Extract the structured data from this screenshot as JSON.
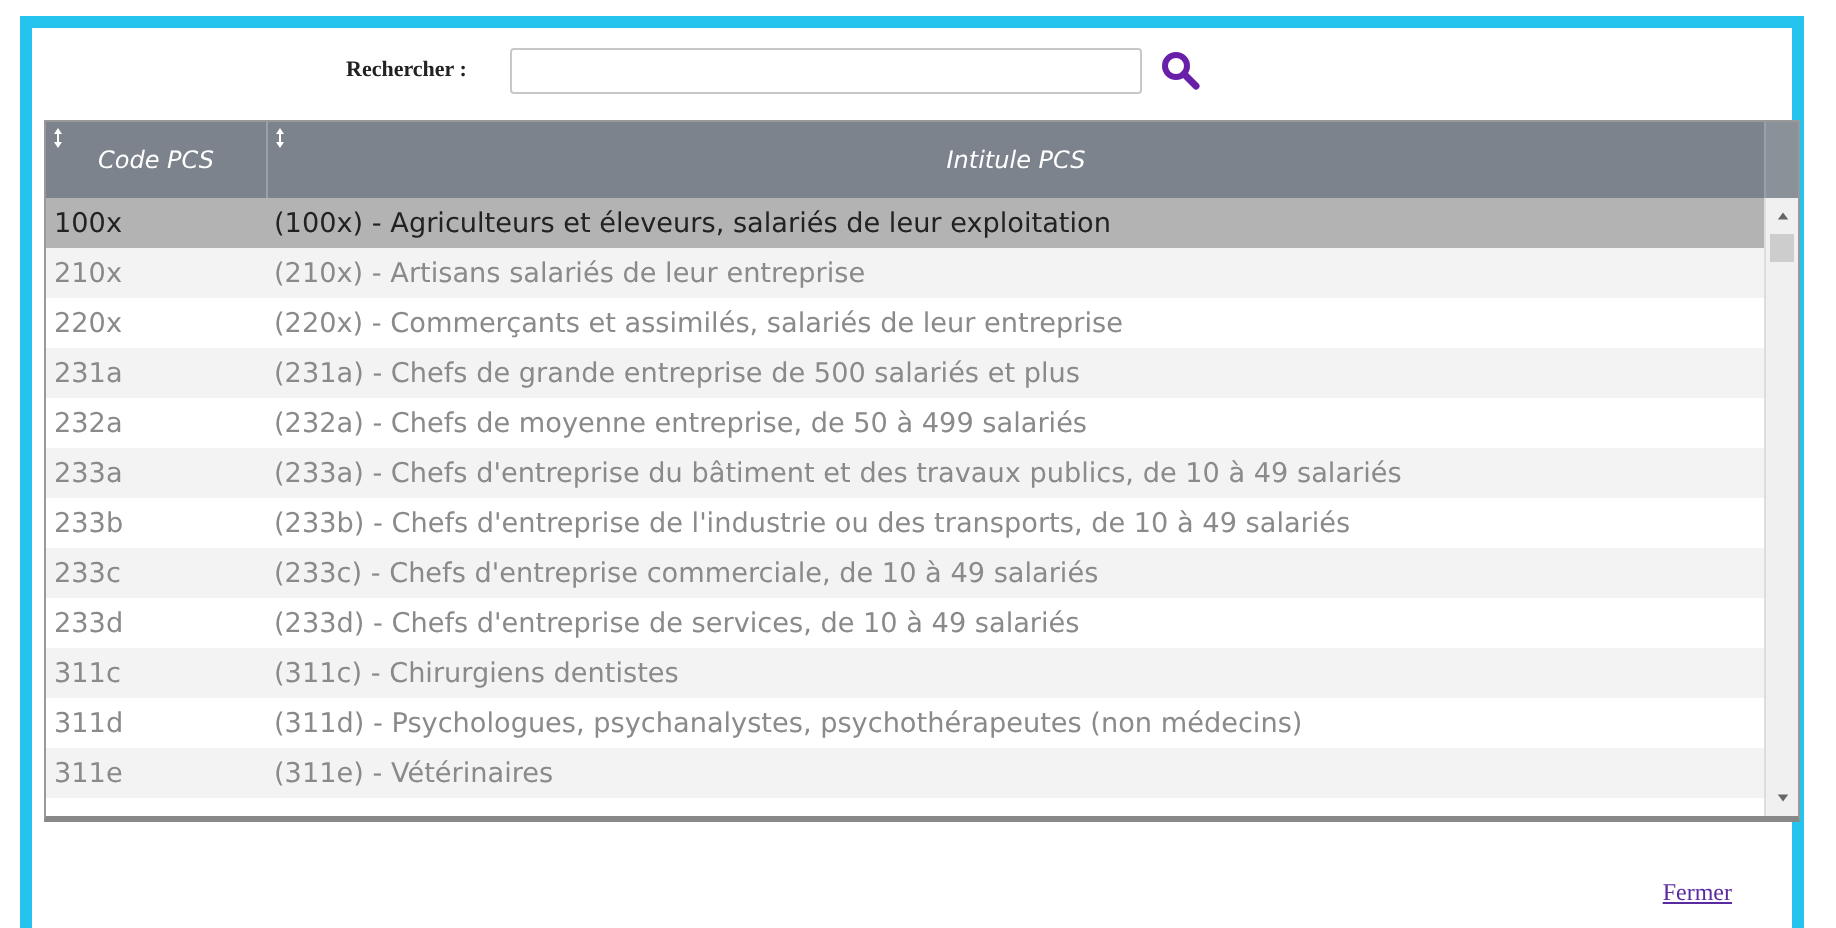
{
  "search": {
    "label": "Rechercher :"
  },
  "table": {
    "columns": [
      "Code PCS",
      "Intitule PCS"
    ],
    "rows": [
      {
        "code": "100x",
        "label": "(100x) - Agriculteurs et éleveurs, salariés de leur exploitation",
        "selected": true
      },
      {
        "code": "210x",
        "label": "(210x) - Artisans salariés de leur entreprise",
        "selected": false
      },
      {
        "code": "220x",
        "label": "(220x) - Commerçants et assimilés, salariés de leur entreprise",
        "selected": false
      },
      {
        "code": "231a",
        "label": "(231a) - Chefs de grande entreprise de 500 salariés et plus",
        "selected": false
      },
      {
        "code": "232a",
        "label": "(232a) - Chefs de moyenne entreprise, de 50 à 499 salariés",
        "selected": false
      },
      {
        "code": "233a",
        "label": "(233a) - Chefs d'entreprise du bâtiment et des travaux publics, de 10 à 49 salariés",
        "selected": false
      },
      {
        "code": "233b",
        "label": "(233b) - Chefs d'entreprise de l'industrie ou des transports, de 10 à 49 salariés",
        "selected": false
      },
      {
        "code": "233c",
        "label": "(233c) - Chefs d'entreprise commerciale, de 10 à 49 salariés",
        "selected": false
      },
      {
        "code": "233d",
        "label": "(233d) - Chefs d'entreprise de services, de 10 à 49 salariés",
        "selected": false
      },
      {
        "code": "311c",
        "label": "(311c) - Chirurgiens dentistes",
        "selected": false
      },
      {
        "code": "311d",
        "label": "(311d) - Psychologues, psychanalystes, psychothérapeutes (non médecins)",
        "selected": false
      },
      {
        "code": "311e",
        "label": "(311e) - Vétérinaires",
        "selected": false
      }
    ]
  },
  "close_link": "Fermer"
}
